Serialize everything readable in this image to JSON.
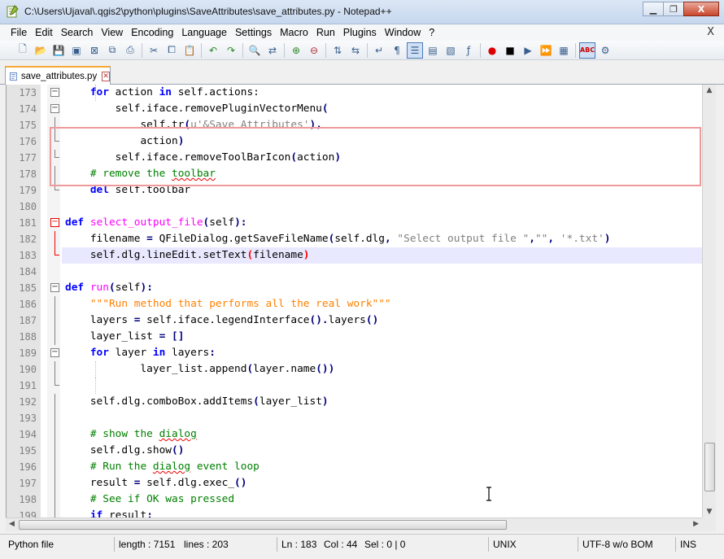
{
  "window": {
    "title": "C:\\Users\\Ujaval\\.qgis2\\python\\plugins\\SaveAttributes\\save_attributes.py - Notepad++",
    "close_label": "X"
  },
  "menu": [
    "File",
    "Edit",
    "Search",
    "View",
    "Encoding",
    "Language",
    "Settings",
    "Macro",
    "Run",
    "Plugins",
    "Window",
    "?"
  ],
  "menu_close": "X",
  "tab": {
    "label": "save_attributes.py"
  },
  "colors": {
    "keyword": "#0000ff",
    "function": "#ff00ff",
    "comment": "#008000",
    "string": "#808080",
    "docstring": "#ff8000",
    "highlight_box": "#ef9a9a",
    "tab_accent": "#f6a935"
  },
  "lines": [
    {
      "n": "173",
      "code": "for action in self.actions:"
    },
    {
      "n": "174",
      "code": "self.iface.removePluginVectorMenu("
    },
    {
      "n": "175",
      "code": "self.tr(u'&Save Attributes'),"
    },
    {
      "n": "176",
      "code": "action)"
    },
    {
      "n": "177",
      "code": "self.iface.removeToolBarIcon(action)"
    },
    {
      "n": "178",
      "code": "# remove the toolbar"
    },
    {
      "n": "179",
      "code": "del self.toolbar"
    },
    {
      "n": "180",
      "code": ""
    },
    {
      "n": "181",
      "code": "def select_output_file(self):"
    },
    {
      "n": "182",
      "code": "filename = QFileDialog.getSaveFileName(self.dlg, \"Select output file \",\"\", '*.txt')"
    },
    {
      "n": "183",
      "code": "self.dlg.lineEdit.setText(filename)"
    },
    {
      "n": "184",
      "code": ""
    },
    {
      "n": "185",
      "code": "def run(self):"
    },
    {
      "n": "186",
      "code": "\"\"\"Run method that performs all the real work\"\"\""
    },
    {
      "n": "187",
      "code": "layers = self.iface.legendInterface().layers()"
    },
    {
      "n": "188",
      "code": "layer_list = []"
    },
    {
      "n": "189",
      "code": "for layer in layers:"
    },
    {
      "n": "190",
      "code": "layer_list.append(layer.name())"
    },
    {
      "n": "191",
      "code": ""
    },
    {
      "n": "192",
      "code": "self.dlg.comboBox.addItems(layer_list)"
    },
    {
      "n": "193",
      "code": ""
    },
    {
      "n": "194",
      "code": "# show the dialog"
    },
    {
      "n": "195",
      "code": "self.dlg.show()"
    },
    {
      "n": "196",
      "code": "# Run the dialog event loop"
    },
    {
      "n": "197",
      "code": "result = self.dlg.exec_()"
    },
    {
      "n": "198",
      "code": "# See if OK was pressed"
    },
    {
      "n": "199",
      "code": "if result:"
    }
  ],
  "status": {
    "file_type": "Python file",
    "length": "length : 7151",
    "lines": "lines : 203",
    "ln": "Ln : 183",
    "col": "Col : 44",
    "sel": "Sel : 0 | 0",
    "eol": "UNIX",
    "encoding": "UTF-8 w/o BOM",
    "mode": "INS"
  }
}
